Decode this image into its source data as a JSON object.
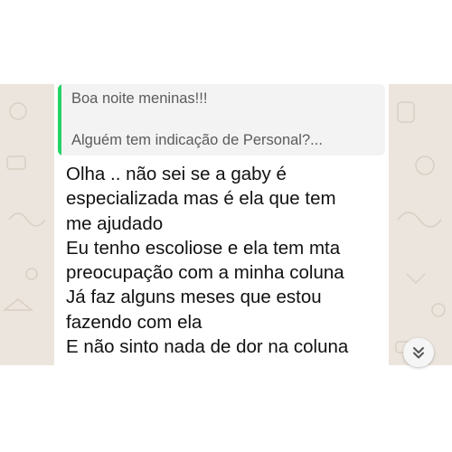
{
  "quoted_message": {
    "line1": "Boa noite meninas!!!",
    "line2": "Alguém tem indicação de Personal?..."
  },
  "message": {
    "lines": [
      "Olha .. não sei se a gaby é",
      "especializada mas é ela que tem",
      "me ajudado",
      "Eu tenho escoliose e ela tem mta",
      "preocupação com a minha coluna",
      "Já faz alguns meses que estou",
      "fazendo com ela",
      "E não sinto nada de dor na coluna"
    ]
  },
  "icons": {
    "scroll_down": "double-chevron-down-icon"
  },
  "colors": {
    "chat_background": "#ece5dd",
    "quote_accent": "#25d366",
    "bubble": "#ffffff"
  }
}
